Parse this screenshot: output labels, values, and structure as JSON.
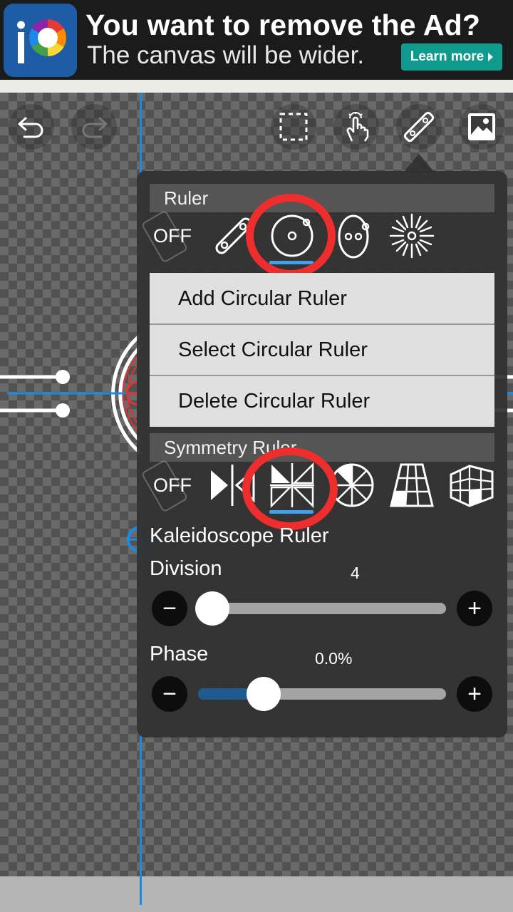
{
  "ad": {
    "title": "You want to remove the Ad?",
    "subtitle": "The canvas will be wider.",
    "cta_label": "Learn more",
    "logo_letters": "iP"
  },
  "toolbar": {
    "undo_icon": "undo-icon",
    "redo_icon": "redo-icon",
    "selection_icon": "selection-rect-icon",
    "hand_icon": "hand-tap-icon",
    "ruler_icon": "ruler-icon",
    "image_icon": "image-icon"
  },
  "ruler_section": {
    "header": "Ruler",
    "off_label": "OFF",
    "tools": [
      "parallel-ruler-icon",
      "circular-ruler-icon",
      "ellipse-ruler-icon",
      "radial-ruler-icon"
    ],
    "selected_tool": "circular-ruler-icon",
    "menu": [
      "Add Circular Ruler",
      "Select Circular Ruler",
      "Delete Circular Ruler"
    ]
  },
  "symmetry_section": {
    "header": "Symmetry Ruler",
    "off_label": "OFF",
    "tools": [
      "mirror-ruler-icon",
      "kaleidoscope-ruler-icon",
      "radial-symmetry-icon",
      "perspective-grid-icon",
      "3d-grid-icon"
    ],
    "selected_tool": "kaleidoscope-ruler-icon",
    "selected_name": "Kaleidoscope Ruler"
  },
  "division": {
    "label": "Division",
    "value": "4",
    "level": 0.0
  },
  "phase": {
    "label": "Phase",
    "value": "0.0%",
    "level": 0.0
  },
  "colors": {
    "accent_blue": "#41a0ea",
    "highlight_red": "#ee2d2d",
    "cta_teal": "#0f9a8e",
    "guide_blue": "#1e88e5"
  }
}
